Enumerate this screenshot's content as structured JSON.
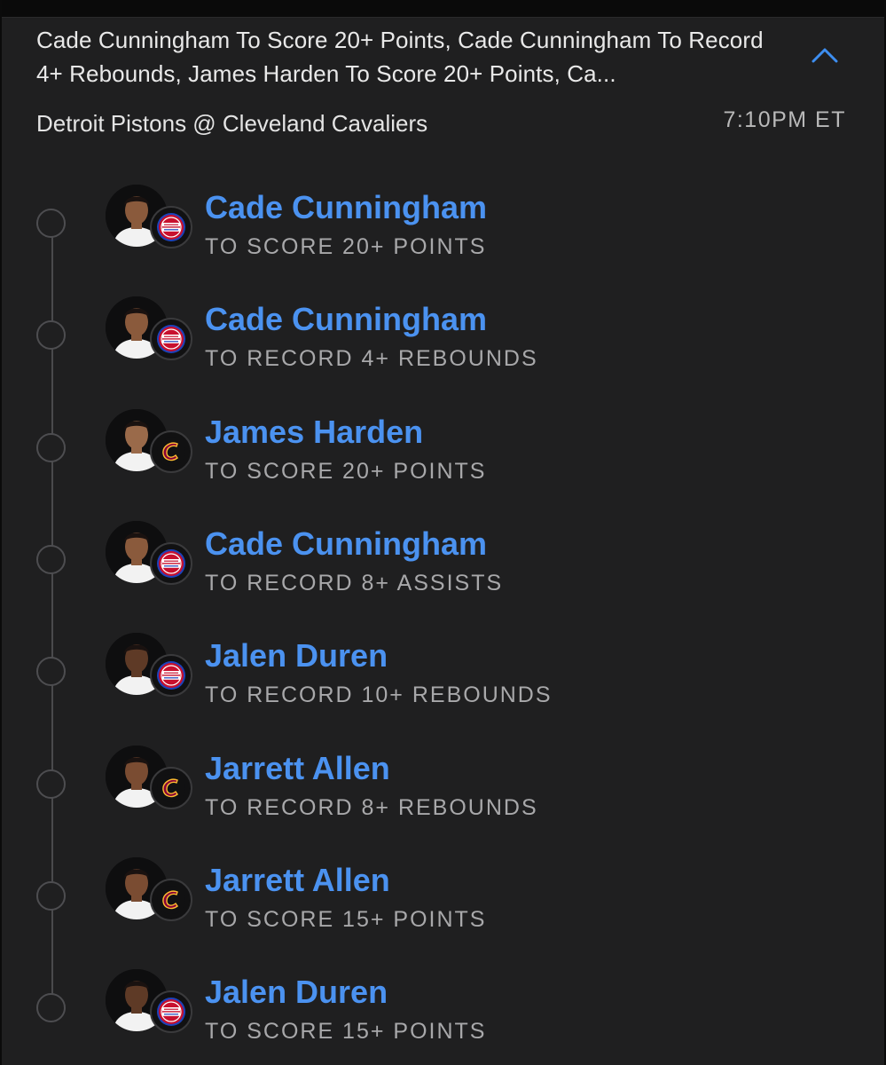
{
  "header": {
    "bet_title": "Cade Cunningham To Score 20+ Points, Cade Cunningham To Record 4+ Rebounds, James Harden To Score 20+ Points, Ca...",
    "collapse_icon": "chevron-up-icon",
    "matchup": "Detroit Pistons @ Cleveland Cavaliers",
    "game_time": "7:10PM ET"
  },
  "colors": {
    "background": "#1f1f20",
    "player_name": "#4b92f0",
    "market_label": "#a8a8aa",
    "chevron": "#3d8ef0",
    "pistons_logo": "#c8102e",
    "cavaliers_logo": "#860038"
  },
  "legs": [
    {
      "player": "Cade Cunningham",
      "market": "TO SCORE 20+ POINTS",
      "team_logo": "pistons-logo",
      "avatar": "player-headshot"
    },
    {
      "player": "Cade Cunningham",
      "market": "TO RECORD 4+ REBOUNDS",
      "team_logo": "pistons-logo",
      "avatar": "player-headshot"
    },
    {
      "player": "James Harden",
      "market": "TO SCORE 20+ POINTS",
      "team_logo": "cavaliers-logo",
      "avatar": "player-headshot"
    },
    {
      "player": "Cade Cunningham",
      "market": "TO RECORD 8+ ASSISTS",
      "team_logo": "pistons-logo",
      "avatar": "player-headshot"
    },
    {
      "player": "Jalen Duren",
      "market": "TO RECORD 10+ REBOUNDS",
      "team_logo": "pistons-logo",
      "avatar": "player-headshot"
    },
    {
      "player": "Jarrett Allen",
      "market": "TO RECORD 8+ REBOUNDS",
      "team_logo": "cavaliers-logo",
      "avatar": "player-headshot"
    },
    {
      "player": "Jarrett Allen",
      "market": "TO SCORE 15+ POINTS",
      "team_logo": "cavaliers-logo",
      "avatar": "player-headshot"
    },
    {
      "player": "Jalen Duren",
      "market": "TO SCORE 15+ POINTS",
      "team_logo": "pistons-logo",
      "avatar": "player-headshot"
    }
  ]
}
